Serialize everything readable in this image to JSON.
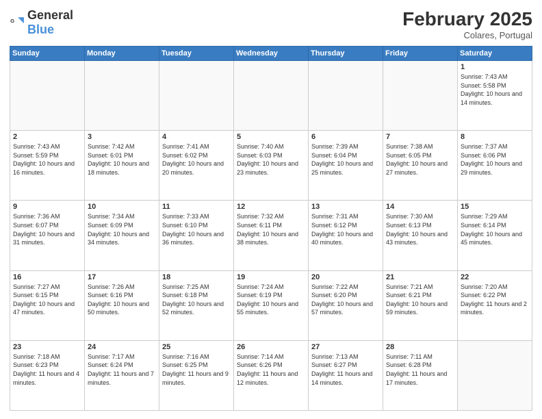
{
  "header": {
    "logo_general": "General",
    "logo_blue": "Blue",
    "month_title": "February 2025",
    "location": "Colares, Portugal"
  },
  "weekdays": [
    "Sunday",
    "Monday",
    "Tuesday",
    "Wednesday",
    "Thursday",
    "Friday",
    "Saturday"
  ],
  "weeks": [
    [
      {
        "day": "",
        "info": ""
      },
      {
        "day": "",
        "info": ""
      },
      {
        "day": "",
        "info": ""
      },
      {
        "day": "",
        "info": ""
      },
      {
        "day": "",
        "info": ""
      },
      {
        "day": "",
        "info": ""
      },
      {
        "day": "1",
        "info": "Sunrise: 7:43 AM\nSunset: 5:58 PM\nDaylight: 10 hours and 14 minutes."
      }
    ],
    [
      {
        "day": "2",
        "info": "Sunrise: 7:43 AM\nSunset: 5:59 PM\nDaylight: 10 hours and 16 minutes."
      },
      {
        "day": "3",
        "info": "Sunrise: 7:42 AM\nSunset: 6:01 PM\nDaylight: 10 hours and 18 minutes."
      },
      {
        "day": "4",
        "info": "Sunrise: 7:41 AM\nSunset: 6:02 PM\nDaylight: 10 hours and 20 minutes."
      },
      {
        "day": "5",
        "info": "Sunrise: 7:40 AM\nSunset: 6:03 PM\nDaylight: 10 hours and 23 minutes."
      },
      {
        "day": "6",
        "info": "Sunrise: 7:39 AM\nSunset: 6:04 PM\nDaylight: 10 hours and 25 minutes."
      },
      {
        "day": "7",
        "info": "Sunrise: 7:38 AM\nSunset: 6:05 PM\nDaylight: 10 hours and 27 minutes."
      },
      {
        "day": "8",
        "info": "Sunrise: 7:37 AM\nSunset: 6:06 PM\nDaylight: 10 hours and 29 minutes."
      }
    ],
    [
      {
        "day": "9",
        "info": "Sunrise: 7:36 AM\nSunset: 6:07 PM\nDaylight: 10 hours and 31 minutes."
      },
      {
        "day": "10",
        "info": "Sunrise: 7:34 AM\nSunset: 6:09 PM\nDaylight: 10 hours and 34 minutes."
      },
      {
        "day": "11",
        "info": "Sunrise: 7:33 AM\nSunset: 6:10 PM\nDaylight: 10 hours and 36 minutes."
      },
      {
        "day": "12",
        "info": "Sunrise: 7:32 AM\nSunset: 6:11 PM\nDaylight: 10 hours and 38 minutes."
      },
      {
        "day": "13",
        "info": "Sunrise: 7:31 AM\nSunset: 6:12 PM\nDaylight: 10 hours and 40 minutes."
      },
      {
        "day": "14",
        "info": "Sunrise: 7:30 AM\nSunset: 6:13 PM\nDaylight: 10 hours and 43 minutes."
      },
      {
        "day": "15",
        "info": "Sunrise: 7:29 AM\nSunset: 6:14 PM\nDaylight: 10 hours and 45 minutes."
      }
    ],
    [
      {
        "day": "16",
        "info": "Sunrise: 7:27 AM\nSunset: 6:15 PM\nDaylight: 10 hours and 47 minutes."
      },
      {
        "day": "17",
        "info": "Sunrise: 7:26 AM\nSunset: 6:16 PM\nDaylight: 10 hours and 50 minutes."
      },
      {
        "day": "18",
        "info": "Sunrise: 7:25 AM\nSunset: 6:18 PM\nDaylight: 10 hours and 52 minutes."
      },
      {
        "day": "19",
        "info": "Sunrise: 7:24 AM\nSunset: 6:19 PM\nDaylight: 10 hours and 55 minutes."
      },
      {
        "day": "20",
        "info": "Sunrise: 7:22 AM\nSunset: 6:20 PM\nDaylight: 10 hours and 57 minutes."
      },
      {
        "day": "21",
        "info": "Sunrise: 7:21 AM\nSunset: 6:21 PM\nDaylight: 10 hours and 59 minutes."
      },
      {
        "day": "22",
        "info": "Sunrise: 7:20 AM\nSunset: 6:22 PM\nDaylight: 11 hours and 2 minutes."
      }
    ],
    [
      {
        "day": "23",
        "info": "Sunrise: 7:18 AM\nSunset: 6:23 PM\nDaylight: 11 hours and 4 minutes."
      },
      {
        "day": "24",
        "info": "Sunrise: 7:17 AM\nSunset: 6:24 PM\nDaylight: 11 hours and 7 minutes."
      },
      {
        "day": "25",
        "info": "Sunrise: 7:16 AM\nSunset: 6:25 PM\nDaylight: 11 hours and 9 minutes."
      },
      {
        "day": "26",
        "info": "Sunrise: 7:14 AM\nSunset: 6:26 PM\nDaylight: 11 hours and 12 minutes."
      },
      {
        "day": "27",
        "info": "Sunrise: 7:13 AM\nSunset: 6:27 PM\nDaylight: 11 hours and 14 minutes."
      },
      {
        "day": "28",
        "info": "Sunrise: 7:11 AM\nSunset: 6:28 PM\nDaylight: 11 hours and 17 minutes."
      },
      {
        "day": "",
        "info": ""
      }
    ]
  ]
}
